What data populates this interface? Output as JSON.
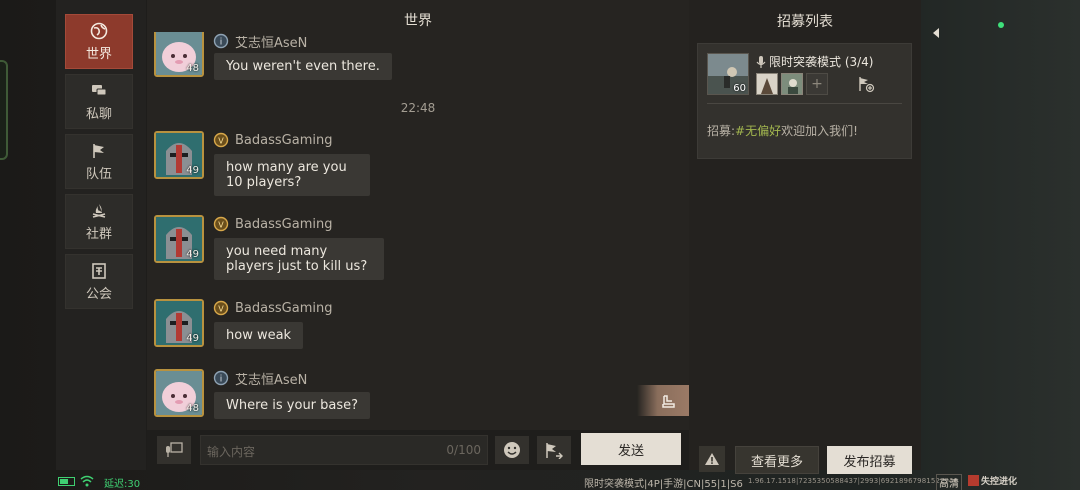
{
  "sidebar": {
    "items": [
      {
        "label": "世界",
        "icon": "globe-icon",
        "active": true
      },
      {
        "label": "私聊",
        "icon": "chat-bubbles-icon",
        "active": false
      },
      {
        "label": "队伍",
        "icon": "flag-icon",
        "active": false
      },
      {
        "label": "社群",
        "icon": "campfire-icon",
        "active": false
      },
      {
        "label": "公会",
        "icon": "guild-banner-icon",
        "active": false
      }
    ]
  },
  "chat": {
    "title": "世界",
    "messages": [
      {
        "sender": "艾志恒AseN",
        "level": "48",
        "text": "You weren't even there."
      },
      {
        "timestamp": "22:48"
      },
      {
        "sender": "BadassGaming",
        "level": "49",
        "text": "how many are you 10 players?"
      },
      {
        "sender": "BadassGaming",
        "level": "49",
        "text": "you need many players just to kill us?"
      },
      {
        "sender": "BadassGaming",
        "level": "49",
        "text": "how weak"
      },
      {
        "sender": "艾志恒AseN",
        "level": "48",
        "text": "Where is your base?"
      }
    ],
    "input": {
      "placeholder": "输入内容",
      "counter": "0/100"
    },
    "send_label": "发送"
  },
  "recruit": {
    "title": "招募列表",
    "card": {
      "level": "60",
      "mode": "限时突袭模式 (3/4)",
      "message_prefix": "招募:",
      "message_tag": "#无偏好",
      "message_suffix": "欢迎加入我们!"
    },
    "more_label": "查看更多",
    "publish_label": "发布招募"
  },
  "status_bar": {
    "latency": "延迟:30",
    "battery_fraction": 0.6,
    "server_info": "限时突袭模式|4P|手游|CN|55|1|S6",
    "build_id": "1.96.17.1518|7235350588437|2993|69218967981522946",
    "quality": "高清",
    "logo": "失控进化"
  },
  "colors": {
    "accent_red": "#8d3a2c",
    "tag_green": "#a3b74f",
    "status_green": "#3fd072",
    "gold_border": "#b8923f"
  }
}
